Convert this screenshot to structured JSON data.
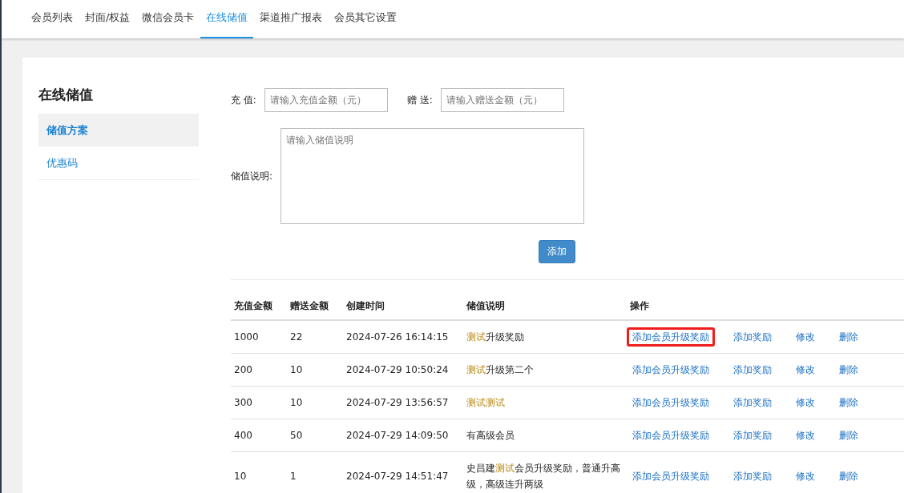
{
  "tabs": [
    {
      "label": "会员列表",
      "selected": false
    },
    {
      "label": "封面/权益",
      "selected": false
    },
    {
      "label": "微信会员卡",
      "selected": false
    },
    {
      "label": "在线储值",
      "selected": true
    },
    {
      "label": "渠道推广报表",
      "selected": false
    },
    {
      "label": "会员其它设置",
      "selected": false
    }
  ],
  "sidebar": {
    "title": "在线储值",
    "items": [
      {
        "label": "储值方案",
        "selected": true
      },
      {
        "label": "优惠码",
        "selected": false
      }
    ]
  },
  "form": {
    "recharge": {
      "label": "充 值:",
      "placeholder": "请输入充值金额（元）"
    },
    "bonus": {
      "label": "赠 送:",
      "placeholder": "请输入赠送金额（元）"
    },
    "description": {
      "label": "储值说明:",
      "placeholder": "请输入储值说明"
    },
    "submit": "添加"
  },
  "table": {
    "columns": [
      "充值金额",
      "赠送金额",
      "创建时间",
      "储值说明",
      "操作"
    ],
    "rows": [
      {
        "amount": "1000",
        "bonus": "22",
        "created": "2024-07-26 16:14:15",
        "description": [
          {
            "text": "测试",
            "highlighted": true
          },
          {
            "text": "升级奖励",
            "highlighted": false
          }
        ],
        "actions": [
          {
            "label": "添加会员升级奖励",
            "outlined": true
          },
          {
            "label": "添加奖励",
            "outlined": false
          },
          {
            "label": "修改",
            "outlined": false
          },
          {
            "label": "删除",
            "outlined": false
          }
        ]
      },
      {
        "amount": "200",
        "bonus": "10",
        "created": "2024-07-29 10:50:24",
        "description": [
          {
            "text": "测试",
            "highlighted": true
          },
          {
            "text": "升级第二个",
            "highlighted": false
          }
        ],
        "actions": [
          {
            "label": "添加会员升级奖励",
            "outlined": false
          },
          {
            "label": "添加奖励",
            "outlined": false
          },
          {
            "label": "修改",
            "outlined": false
          },
          {
            "label": "删除",
            "outlined": false
          }
        ]
      },
      {
        "amount": "300",
        "bonus": "10",
        "created": "2024-07-29 13:56:57",
        "description": [
          {
            "text": "测试测试",
            "highlighted": true
          }
        ],
        "actions": [
          {
            "label": "添加会员升级奖励",
            "outlined": false
          },
          {
            "label": "添加奖励",
            "outlined": false
          },
          {
            "label": "修改",
            "outlined": false
          },
          {
            "label": "删除",
            "outlined": false
          }
        ]
      },
      {
        "amount": "400",
        "bonus": "50",
        "created": "2024-07-29 14:09:50",
        "description": [
          {
            "text": "有高级会员",
            "highlighted": false
          }
        ],
        "actions": [
          {
            "label": "添加会员升级奖励",
            "outlined": false
          },
          {
            "label": "添加奖励",
            "outlined": false
          },
          {
            "label": "修改",
            "outlined": false
          },
          {
            "label": "删除",
            "outlined": false
          }
        ]
      },
      {
        "amount": "10",
        "bonus": "1",
        "created": "2024-07-29 14:51:47",
        "description": [
          {
            "text": "史昌建",
            "highlighted": false
          },
          {
            "text": "测试",
            "highlighted": true
          },
          {
            "text": "会员升级奖励，普通升高级，高级连升两级",
            "highlighted": false
          }
        ],
        "actions": [
          {
            "label": "添加会员升级奖励",
            "outlined": false
          },
          {
            "label": "添加奖励",
            "outlined": false
          },
          {
            "label": "修改",
            "outlined": false
          },
          {
            "label": "删除",
            "outlined": false
          }
        ]
      }
    ]
  }
}
